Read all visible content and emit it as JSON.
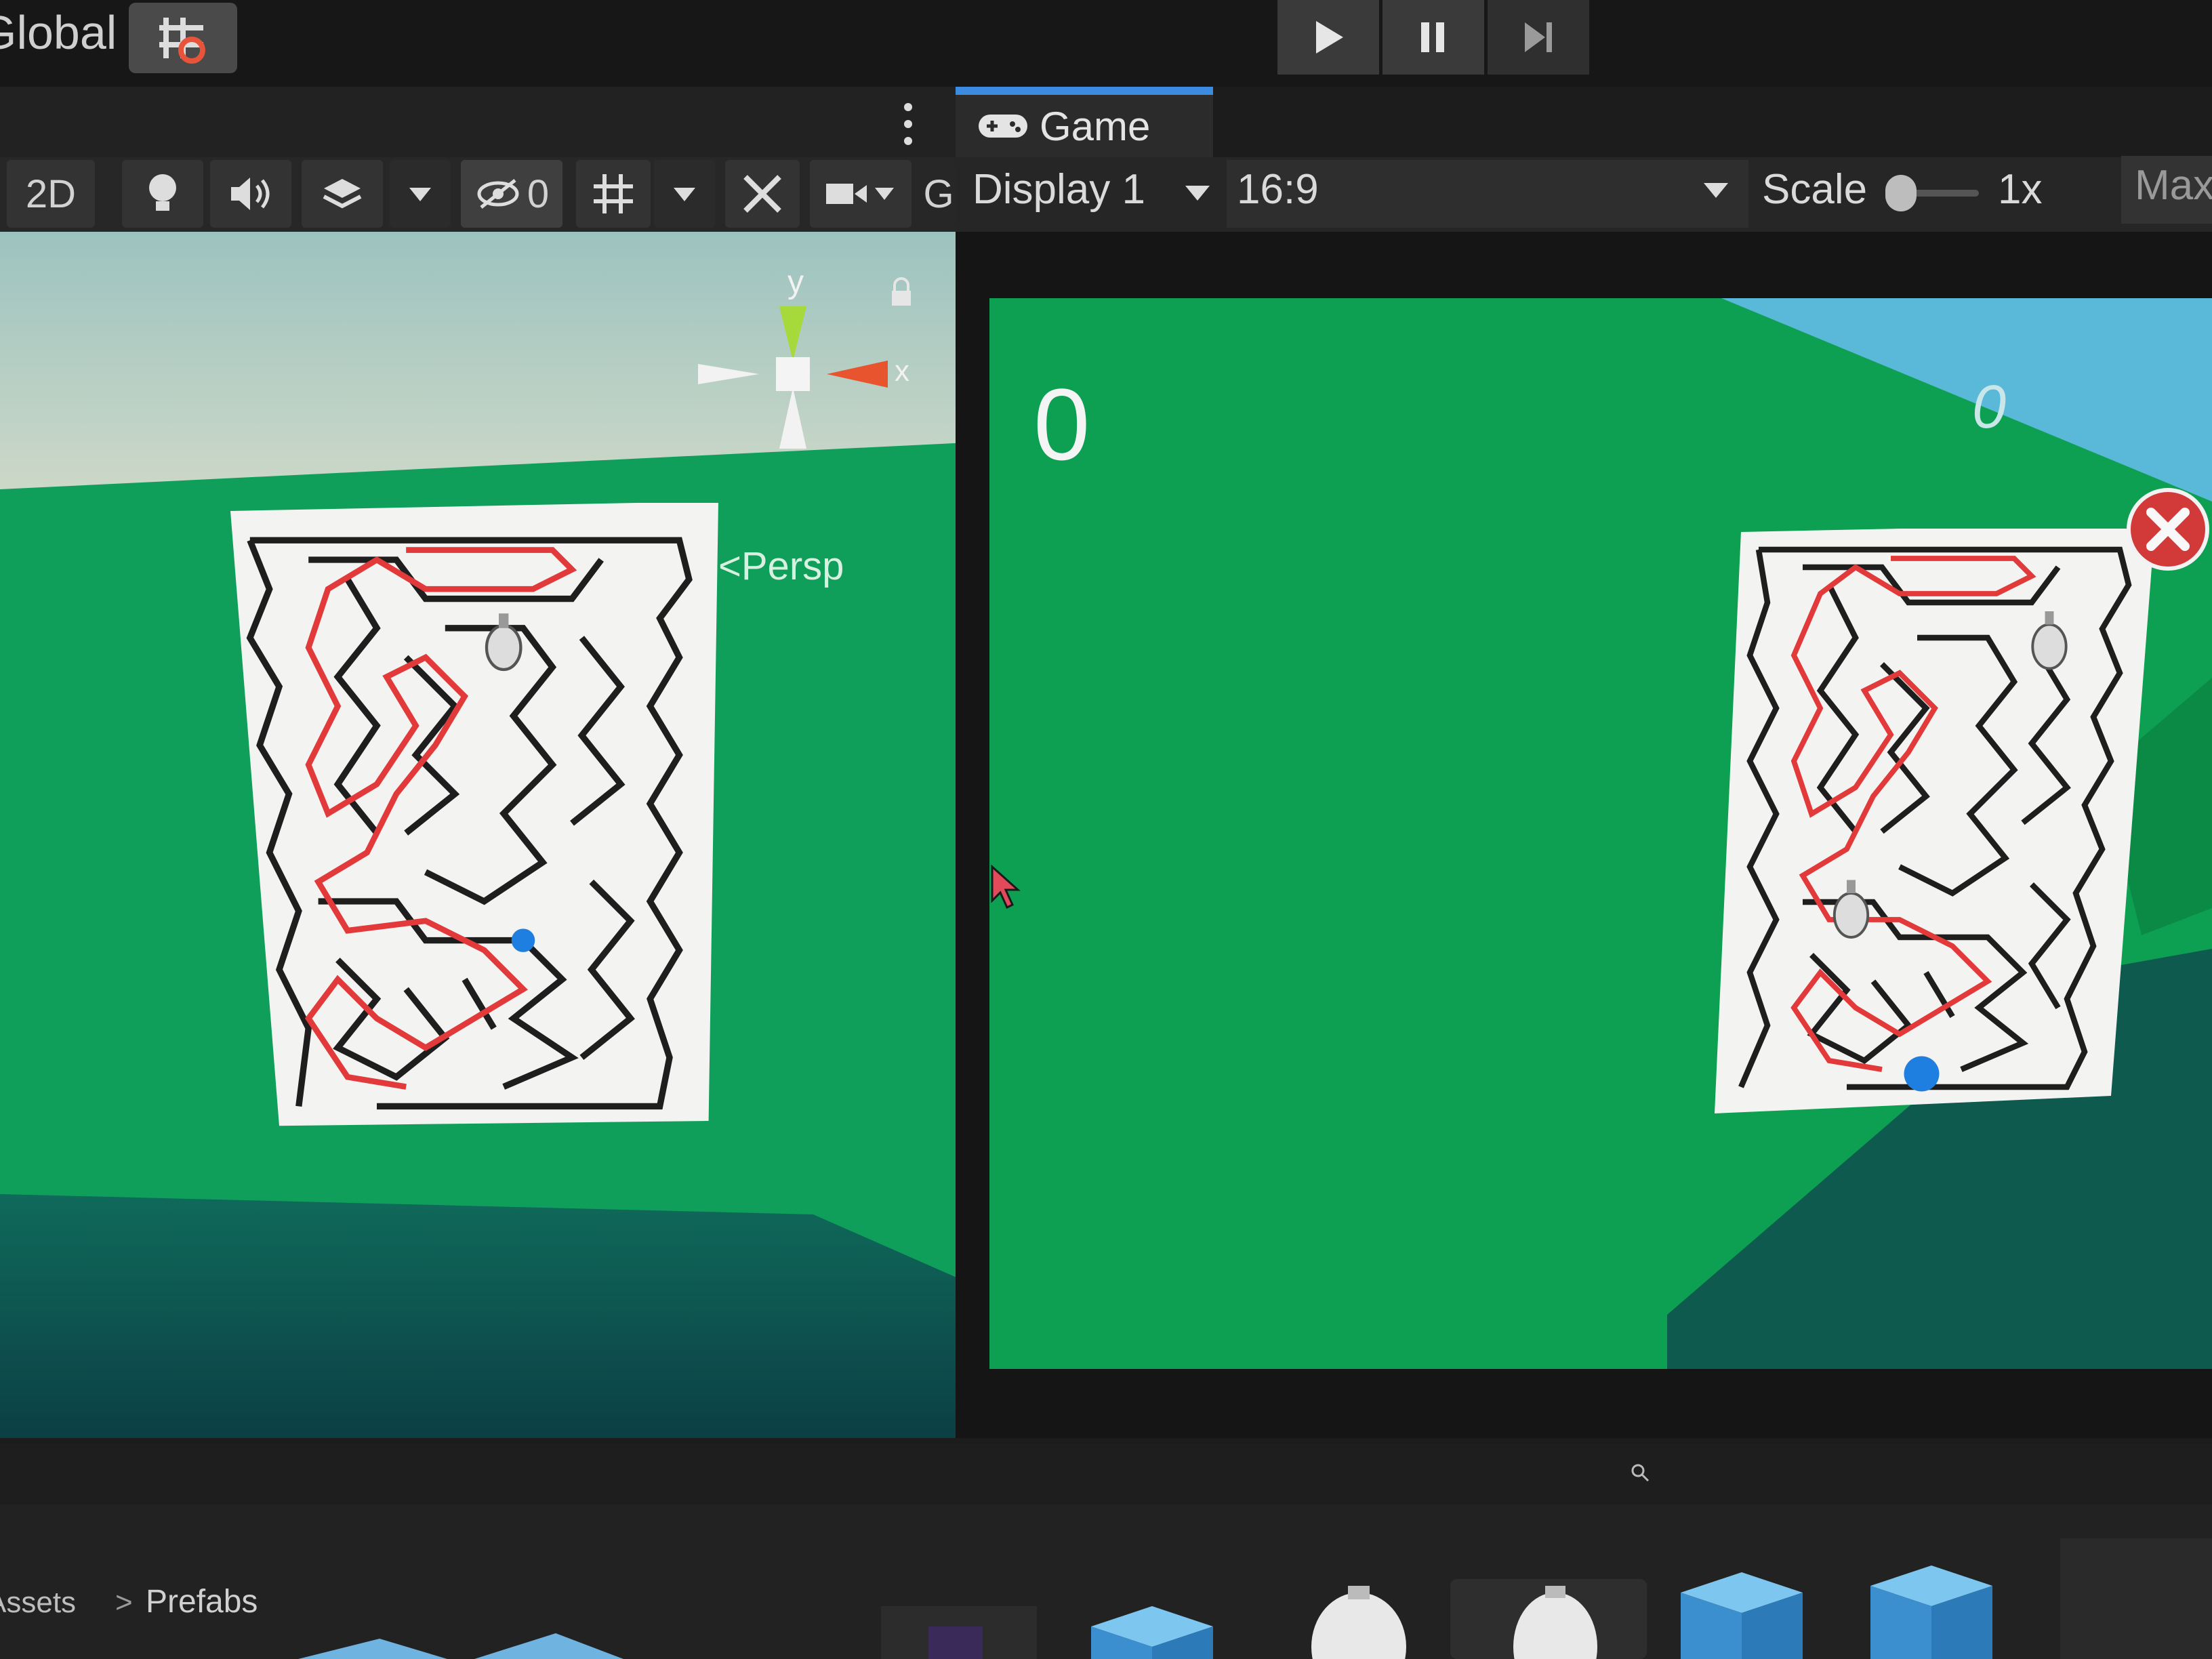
{
  "toolbar": {
    "global_label": "Global",
    "snap_icon": "grid-snap-icon",
    "play_icon": "play-icon",
    "pause_icon": "pause-icon",
    "step_icon": "step-icon"
  },
  "scene": {
    "more_icon": "kebab-menu-icon",
    "mode_2d": "2D",
    "hidden_count": "0",
    "persp_label": "<Persp",
    "gizmo_y": "y",
    "gizmo_x": "x",
    "cutoff_label": "G"
  },
  "game": {
    "tab_label": "Game",
    "display": "Display 1",
    "aspect": "16:9",
    "scale_label": "Scale",
    "scale_value": "1x",
    "maximize_label": "Max",
    "score_left": "0",
    "score_right": "0"
  },
  "project": {
    "breadcrumb_root": "Assets",
    "breadcrumb_sep": ">",
    "breadcrumb_current": "Prefabs"
  },
  "colors": {
    "accent": "#3d8be0",
    "ground_green": "#0da052",
    "maze_path": "#e23a3a",
    "ball": "#1f7fe0",
    "close_button": "#d23a3a"
  }
}
